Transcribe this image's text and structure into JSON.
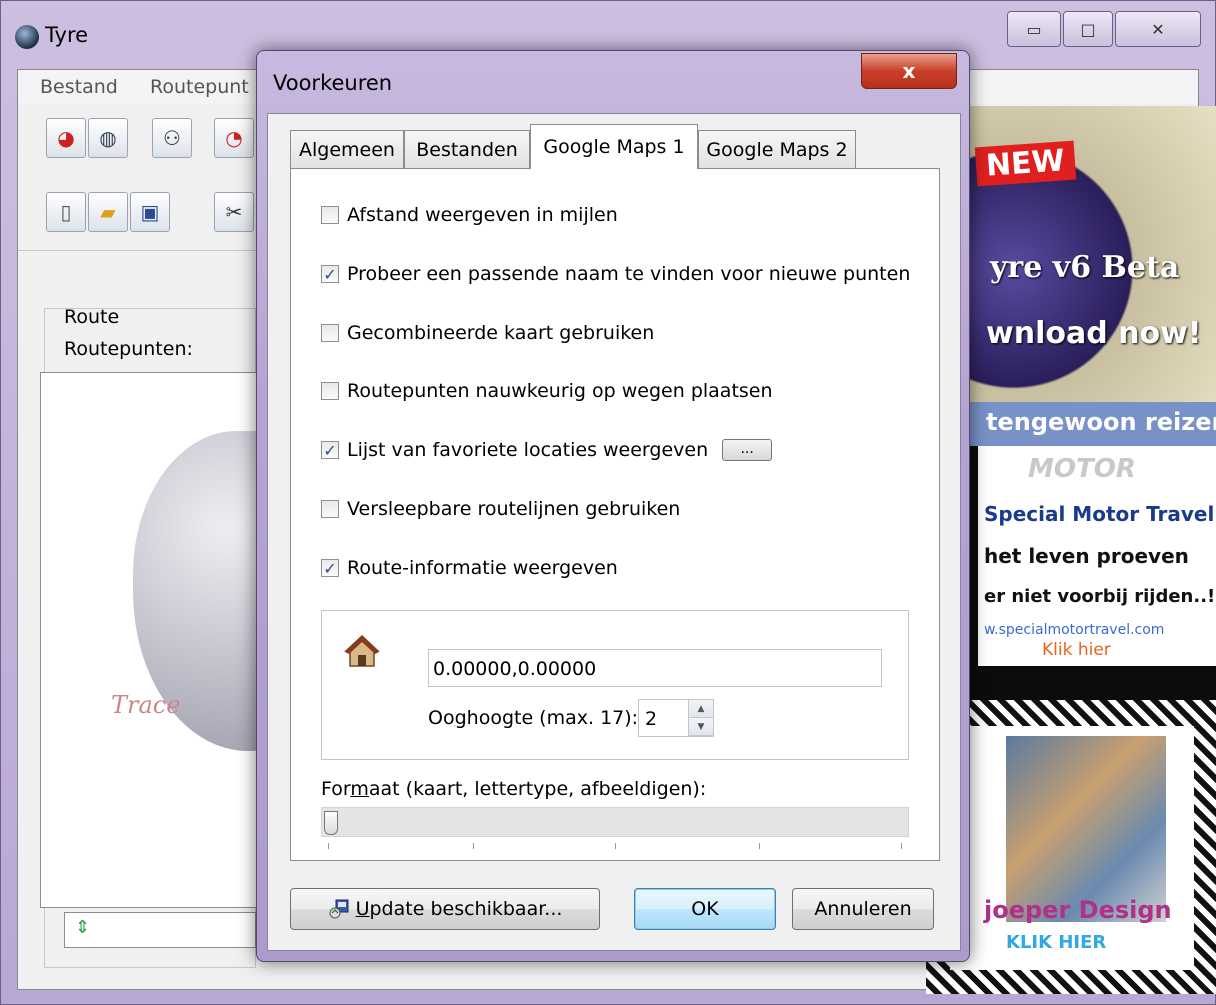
{
  "main_window": {
    "title": "Tyre",
    "controls": {
      "minimize": "▭",
      "maximize": "□",
      "close": "✕"
    }
  },
  "menubar": {
    "items": [
      "Bestand",
      "Routepunt"
    ]
  },
  "left_panel": {
    "route_label": "Route",
    "routepunten_label": "Routepunten:",
    "logo_text": "Trace"
  },
  "ads": {
    "ad1": {
      "badge": "NEW",
      "beta": "yre v6 Beta",
      "download": "wnload now!"
    },
    "ad2": {
      "banner": "tengewoon reizen",
      "brand": "MOTOR",
      "line1": "Special Motor Travel",
      "line2": "het leven proeven",
      "line3": "er niet voorbij rijden..!",
      "url": "w.specialmotortravel.com",
      "klik": "Klik hier"
    },
    "ad3": {
      "title": "joeper Design",
      "klik": "KLIK HIER"
    }
  },
  "dialog": {
    "title": "Voorkeuren",
    "close": "x",
    "tabs": [
      "Algemeen",
      "Bestanden",
      "Google Maps 1",
      "Google Maps 2"
    ],
    "active_tab": "Google Maps 1",
    "options": [
      {
        "label": "Afstand weergeven in mijlen",
        "checked": false
      },
      {
        "label": "Probeer een passende naam te vinden voor nieuwe punten",
        "checked": true
      },
      {
        "label": "Gecombineerde kaart gebruiken",
        "checked": false
      },
      {
        "label": "Routepunten nauwkeurig op wegen plaatsen",
        "checked": false
      },
      {
        "label": "Lijst van favoriete locaties weergeven",
        "checked": true
      },
      {
        "label": "Versleepbare routelijnen gebruiken",
        "checked": false
      },
      {
        "label": "Route-informatie weergeven",
        "checked": true
      }
    ],
    "favorites_button": "...",
    "home": {
      "coordinates": "0.00000,0.00000",
      "ooghoogte_label_pre": "Oo",
      "ooghoogte_label_mnemonic": "g",
      "ooghoogte_label_post": "hoogte (max. 17):",
      "ooghoogte_value": "2"
    },
    "formaat_label_pre": "For",
    "formaat_label_mnemonic": "m",
    "formaat_label_post": "aat (kaart, lettertype, afbeeldigen):",
    "formaat_value": 0,
    "buttons": {
      "update_mnemonic": "U",
      "update_rest": "pdate beschikbaar...",
      "ok": "OK",
      "cancel": "Annuleren"
    }
  }
}
